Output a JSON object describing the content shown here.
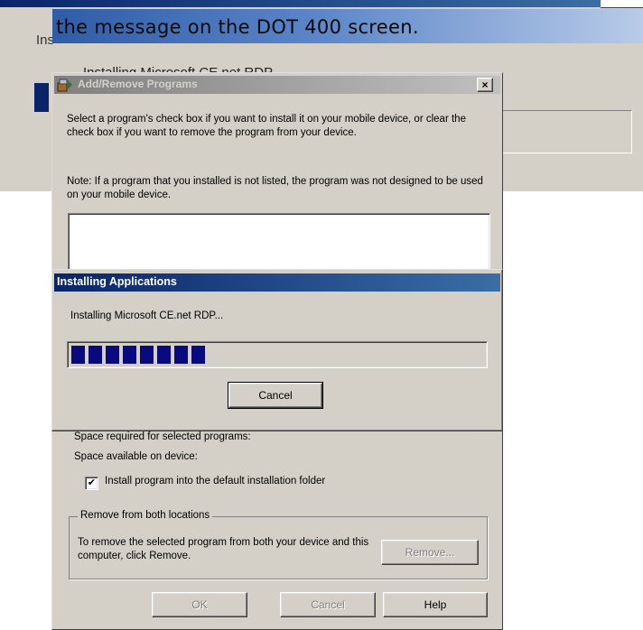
{
  "background_window": {
    "partial_label": "Ins",
    "installing_text": "Installing Microsoft CE.net RDP"
  },
  "caption": {
    "text": "the message on the DOT 400 screen."
  },
  "add_remove": {
    "title": "Add/Remove Programs",
    "close_glyph": "×",
    "description": "Select a program's check box if you want to install it on your mobile device, or clear the check box if you want to remove the program from your device.",
    "note": "Note:  If a program that you installed is not listed, the program was not designed to be used on your mobile device.",
    "space_required_label": "Space required for selected programs:",
    "space_available_label": "Space available on device:",
    "default_folder_checkbox": {
      "checked": true,
      "glyph": "✔",
      "label": "Install program into the default installation folder"
    },
    "remove_group": {
      "label": "Remove from both locations",
      "text": "To remove the selected program from both your device and this computer, click Remove.",
      "remove_button": "Remove..."
    },
    "buttons": {
      "ok": "OK",
      "cancel": "Cancel",
      "help": "Help"
    }
  },
  "installing_dialog": {
    "title": "Installing Applications",
    "status_text": "Installing Microsoft CE.net RDP...",
    "progress_blocks_filled": 8,
    "cancel_button": "Cancel"
  },
  "colors": {
    "active_title": "#0a246a",
    "inactive_title": "#808080",
    "dialog_face": "#d4d0c8",
    "progress_block": "#0a0a80"
  },
  "icons": {
    "add_remove_title_icon": "install-package-icon",
    "close": "close-icon",
    "checkbox": "checkmark-icon"
  }
}
